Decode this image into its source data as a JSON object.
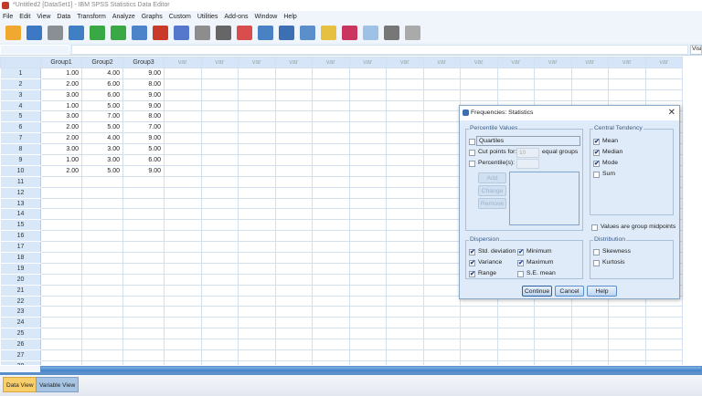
{
  "window": {
    "title": "*Untitled2 [DataSet1] - IBM SPSS Statistics Data Editor"
  },
  "menu": [
    "File",
    "Edit",
    "View",
    "Data",
    "Transform",
    "Analyze",
    "Graphs",
    "Custom",
    "Utilities",
    "Add-ons",
    "Window",
    "Help"
  ],
  "toolbar": [
    {
      "icon": "open-icon",
      "color": "#f0a830"
    },
    {
      "icon": "save-icon",
      "color": "#3c78c3"
    },
    {
      "icon": "print-icon",
      "color": "#8a8f96"
    },
    {
      "icon": "recall-dialog-icon",
      "color": "#3f7fc4"
    },
    {
      "icon": "undo-icon",
      "color": "#3aa845"
    },
    {
      "icon": "redo-icon",
      "color": "#3aa845"
    },
    {
      "icon": "goto-case-icon",
      "color": "#4b84c9"
    },
    {
      "icon": "goto-variable-icon",
      "color": "#c93a2a"
    },
    {
      "icon": "variables-icon",
      "color": "#5577cc"
    },
    {
      "icon": "run-descriptives-icon",
      "color": "#8d8d8d"
    },
    {
      "icon": "find-icon",
      "color": "#666"
    },
    {
      "icon": "insert-cases-icon",
      "color": "#d94d4d"
    },
    {
      "icon": "insert-variable-icon",
      "color": "#4a80c4"
    },
    {
      "icon": "split-file-icon",
      "color": "#3d6fb5"
    },
    {
      "icon": "weight-cases-icon",
      "color": "#5a8fcb"
    },
    {
      "icon": "select-cases-icon",
      "color": "#e6c040"
    },
    {
      "icon": "value-labels-icon",
      "color": "#c9355f"
    },
    {
      "icon": "use-sets-icon",
      "color": "#9ec1e8"
    },
    {
      "icon": "show-all-variables-icon",
      "color": "#777"
    },
    {
      "icon": "spell-check-icon",
      "color": "#aaa"
    }
  ],
  "editor": {
    "visible_label": "Visi"
  },
  "grid": {
    "columns": [
      "Group1",
      "Group2",
      "Group3",
      "var",
      "var",
      "var",
      "var",
      "var",
      "var",
      "var",
      "var",
      "var",
      "var",
      "var",
      "var",
      "var",
      "var"
    ],
    "rows": [
      [
        "1.00",
        "4.00",
        "9.00"
      ],
      [
        "2.00",
        "6.00",
        "8.00"
      ],
      [
        "3.00",
        "6.00",
        "9.00"
      ],
      [
        "1.00",
        "5.00",
        "9.00"
      ],
      [
        "3.00",
        "7.00",
        "8.00"
      ],
      [
        "2.00",
        "5.00",
        "7.00"
      ],
      [
        "2.00",
        "4.00",
        "9.00"
      ],
      [
        "3.00",
        "3.00",
        "5.00"
      ],
      [
        "1.00",
        "3.00",
        "6.00"
      ],
      [
        "2.00",
        "5.00",
        "9.00"
      ]
    ],
    "row_count": 28
  },
  "tabs": {
    "data_view": "Data View",
    "variable_view": "Variable View",
    "active": "Data View"
  },
  "dialog": {
    "title": "Frequencies: Statistics",
    "percentile": {
      "label": "Percentile Values",
      "quartiles": "Quartiles",
      "cut_points": "Cut points for:",
      "cut_value": "10",
      "equal_groups": "equal groups",
      "percentiles": "Percentile(s):",
      "add": "Add",
      "change": "Change",
      "remove": "Remove"
    },
    "central": {
      "label": "Central Tendency",
      "items": [
        {
          "label": "Mean",
          "checked": true
        },
        {
          "label": "Median",
          "checked": true
        },
        {
          "label": "Mode",
          "checked": true
        },
        {
          "label": "Sum",
          "checked": false
        }
      ]
    },
    "midpoints": "Values are group midpoints",
    "dispersion": {
      "label": "Dispersion",
      "items": [
        {
          "label": "Std. deviation",
          "checked": true
        },
        {
          "label": "Minimum",
          "checked": true
        },
        {
          "label": "Variance",
          "checked": true
        },
        {
          "label": "Maximum",
          "checked": true
        },
        {
          "label": "Range",
          "checked": true
        },
        {
          "label": "S.E. mean",
          "checked": false
        }
      ]
    },
    "distribution": {
      "label": "Distribution",
      "items": [
        {
          "label": "Skewness",
          "checked": false
        },
        {
          "label": "Kurtosis",
          "checked": false
        }
      ]
    },
    "buttons": {
      "continue": "Continue",
      "cancel": "Cancel",
      "help": "Help"
    }
  }
}
